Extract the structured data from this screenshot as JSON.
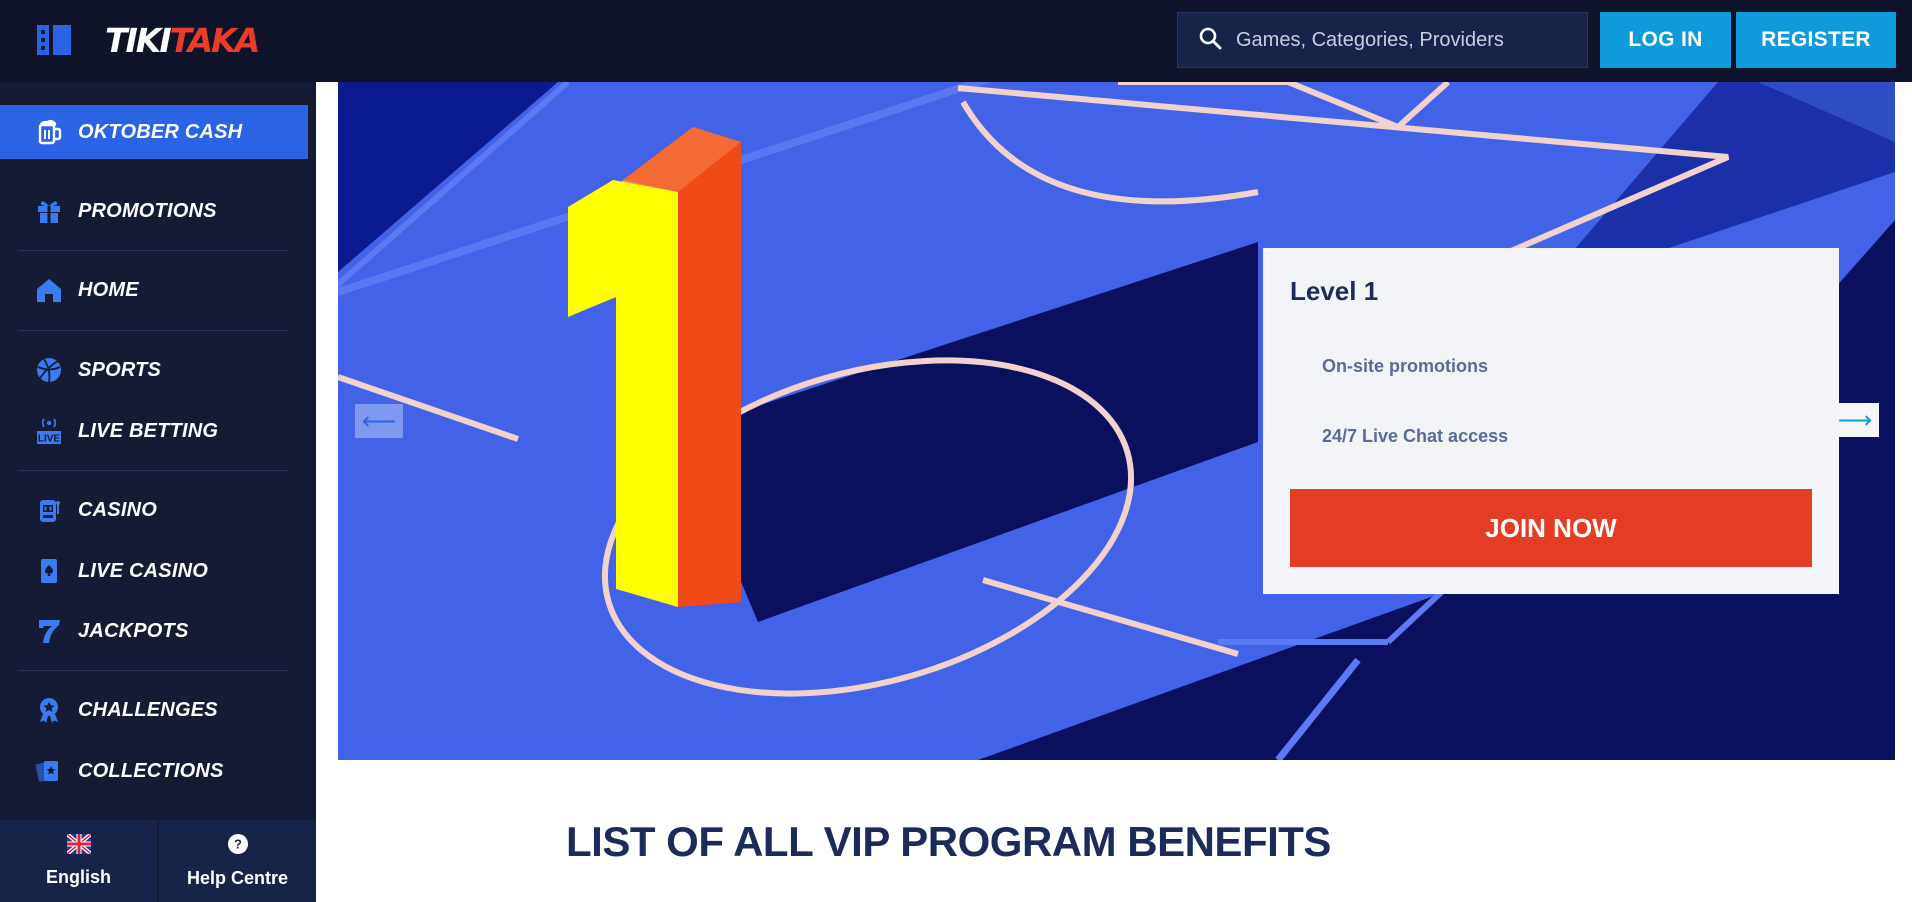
{
  "header": {
    "logo_part1": "TIKI",
    "logo_part2": "TAKA",
    "search_placeholder": "Games, Categories, Providers",
    "login_label": "LOG IN",
    "register_label": "REGISTER"
  },
  "sidebar": {
    "items": [
      {
        "label": "OKTOBER CASH",
        "icon": "beer-mug-icon",
        "active": true
      },
      {
        "label": "PROMOTIONS",
        "icon": "gift-icon"
      },
      {
        "label": "HOME",
        "icon": "home-icon"
      },
      {
        "label": "SPORTS",
        "icon": "basketball-icon"
      },
      {
        "label": "LIVE BETTING",
        "icon": "live-broadcast-icon"
      },
      {
        "label": "CASINO",
        "icon": "slot-machine-icon"
      },
      {
        "label": "LIVE CASINO",
        "icon": "playing-card-spade-icon"
      },
      {
        "label": "JACKPOTS",
        "icon": "lucky-seven-icon"
      },
      {
        "label": "CHALLENGES",
        "icon": "medal-star-icon"
      },
      {
        "label": "COLLECTIONS",
        "icon": "cards-collection-icon"
      }
    ],
    "live_badge": "LIVE",
    "footer": {
      "language": "English",
      "help": "Help Centre",
      "help_glyph": "?"
    }
  },
  "banner": {
    "level_number": "1",
    "level_title": "Level 1",
    "benefits": [
      "On-site promotions",
      "24/7 Live Chat access"
    ],
    "join_label": "JOIN NOW",
    "prev_glyph": "⟵",
    "next_glyph": "⟶"
  },
  "section_title": "LIST OF ALL VIP PROGRAM BENEFITS",
  "colors": {
    "header_bg": "#0f1329",
    "sidebar_bg": "#151a35",
    "active_item": "#2a63e4",
    "button_blue": "#0f9adb",
    "join_red": "#e43d26",
    "pitch_blue": "#4263e8",
    "pitch_dark": "#0a0f5e",
    "title_navy": "#1d2b5a"
  }
}
